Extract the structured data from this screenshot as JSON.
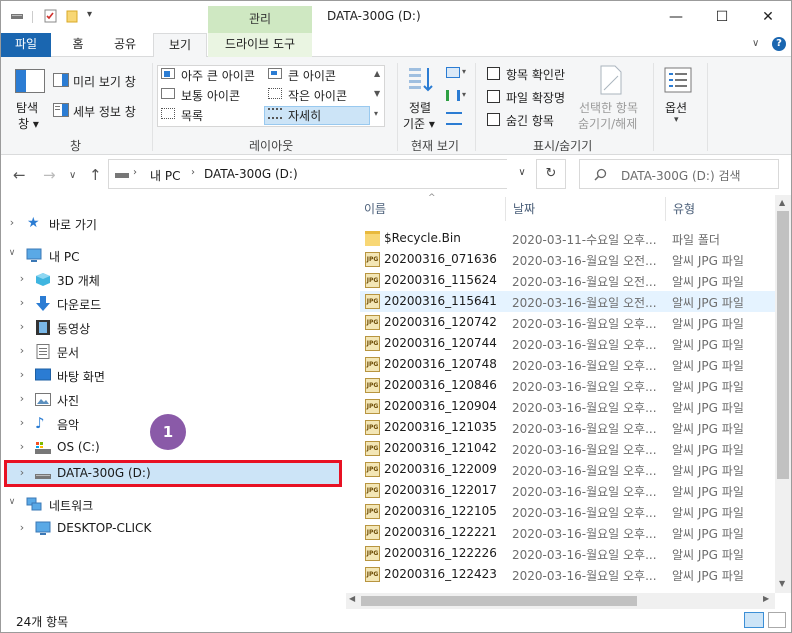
{
  "window": {
    "title": "DATA-300G (D:)",
    "context_tab": "관리",
    "controls": {
      "minimize": "—",
      "maximize": "☐",
      "close": "✕"
    }
  },
  "ribbon_tabs": {
    "file": "파일",
    "home": "홈",
    "share": "공유",
    "view": "보기",
    "drive_tools": "드라이브 도구"
  },
  "ribbon": {
    "pane_group": {
      "navpane_label_line1": "탐색",
      "navpane_label_line2": "창 ▾",
      "preview": "미리 보기 창",
      "details": "세부 정보 창",
      "group_label": "창"
    },
    "layout_group": {
      "options": [
        "아주 큰 아이콘",
        "큰 아이콘",
        "보통 아이콘",
        "작은 아이콘",
        "목록",
        "자세히"
      ],
      "selected": "자세히",
      "group_label": "레이아웃"
    },
    "current_view_group": {
      "sort_line1": "정렬",
      "sort_line2": "기준 ▾",
      "group_label": "현재 보기"
    },
    "show_hide_group": {
      "item_checkboxes": "항목 확인란",
      "file_extensions": "파일 확장명",
      "hidden_items": "숨긴 항목",
      "hide_selected_line1": "선택한 항목",
      "hide_selected_line2": "숨기기/해제",
      "group_label": "표시/숨기기"
    },
    "options_label": "옵션",
    "accent": "#1a66b0"
  },
  "address": {
    "path": [
      "내 PC",
      "DATA-300G (D:)"
    ],
    "search_placeholder": "DATA-300G (D:) 검색"
  },
  "nav_pane": {
    "quick_access": "바로 가기",
    "this_pc": "내 PC",
    "items": [
      "3D 개체",
      "다운로드",
      "동영상",
      "문서",
      "바탕 화면",
      "사진",
      "음악",
      "OS (C:)",
      "DATA-300G (D:)"
    ],
    "network": "네트워크",
    "network_items": [
      "DESKTOP-CLICK"
    ]
  },
  "columns": {
    "name": "이름",
    "date": "날짜",
    "type": "유형"
  },
  "files": [
    {
      "name": "$Recycle.Bin",
      "date": "2020-03-11-수요일 오후...",
      "type": "파일 폴더",
      "icon": "folder"
    },
    {
      "name": "20200316_071636",
      "date": "2020-03-16-월요일 오전...",
      "type": "알씨 JPG 파일",
      "icon": "jpg"
    },
    {
      "name": "20200316_115624",
      "date": "2020-03-16-월요일 오전...",
      "type": "알씨 JPG 파일",
      "icon": "jpg"
    },
    {
      "name": "20200316_115641",
      "date": "2020-03-16-월요일 오전...",
      "type": "알씨 JPG 파일",
      "icon": "jpg"
    },
    {
      "name": "20200316_120742",
      "date": "2020-03-16-월요일 오후...",
      "type": "알씨 JPG 파일",
      "icon": "jpg"
    },
    {
      "name": "20200316_120744",
      "date": "2020-03-16-월요일 오후...",
      "type": "알씨 JPG 파일",
      "icon": "jpg"
    },
    {
      "name": "20200316_120748",
      "date": "2020-03-16-월요일 오후...",
      "type": "알씨 JPG 파일",
      "icon": "jpg"
    },
    {
      "name": "20200316_120846",
      "date": "2020-03-16-월요일 오후...",
      "type": "알씨 JPG 파일",
      "icon": "jpg"
    },
    {
      "name": "20200316_120904",
      "date": "2020-03-16-월요일 오후...",
      "type": "알씨 JPG 파일",
      "icon": "jpg"
    },
    {
      "name": "20200316_121035",
      "date": "2020-03-16-월요일 오후...",
      "type": "알씨 JPG 파일",
      "icon": "jpg"
    },
    {
      "name": "20200316_121042",
      "date": "2020-03-16-월요일 오후...",
      "type": "알씨 JPG 파일",
      "icon": "jpg"
    },
    {
      "name": "20200316_122009",
      "date": "2020-03-16-월요일 오후...",
      "type": "알씨 JPG 파일",
      "icon": "jpg"
    },
    {
      "name": "20200316_122017",
      "date": "2020-03-16-월요일 오후...",
      "type": "알씨 JPG 파일",
      "icon": "jpg"
    },
    {
      "name": "20200316_122105",
      "date": "2020-03-16-월요일 오후...",
      "type": "알씨 JPG 파일",
      "icon": "jpg"
    },
    {
      "name": "20200316_122221",
      "date": "2020-03-16-월요일 오후...",
      "type": "알씨 JPG 파일",
      "icon": "jpg"
    },
    {
      "name": "20200316_122226",
      "date": "2020-03-16-월요일 오후...",
      "type": "알씨 JPG 파일",
      "icon": "jpg"
    },
    {
      "name": "20200316_122423",
      "date": "2020-03-16-월요일 오후...",
      "type": "알씨 JPG 파일",
      "icon": "jpg"
    }
  ],
  "status": {
    "count": "24개 항목"
  },
  "annotation": {
    "badge": "1",
    "badge_color": "#8a5aa8",
    "highlight_color": "#e81123"
  }
}
